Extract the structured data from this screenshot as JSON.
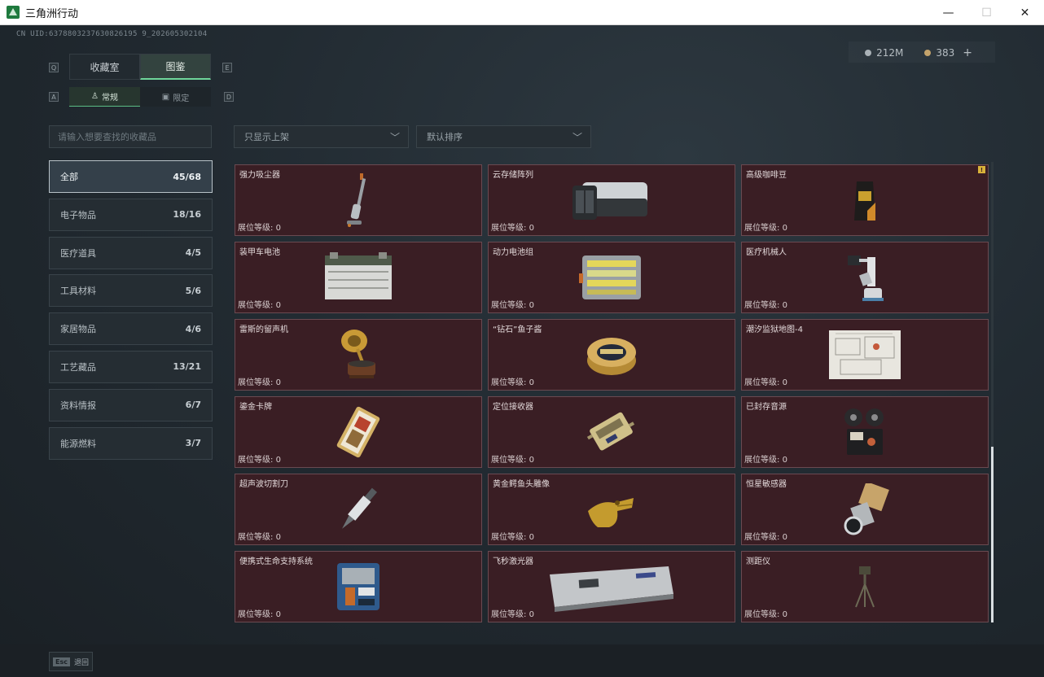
{
  "window": {
    "title": "三角洲行动",
    "minimize": "—",
    "maximize": "☐",
    "close": "✕"
  },
  "uid": "CN UID:6378803237630826195 9_202605302104",
  "currency": {
    "silver": "212M",
    "gold": "383",
    "add": "+"
  },
  "keys": {
    "prev_tab": "Q",
    "next_tab": "E",
    "prev_sub": "A",
    "next_sub": "D"
  },
  "tabs": [
    {
      "label": "收藏室"
    },
    {
      "label": "图鉴"
    }
  ],
  "subtabs": [
    {
      "label": "常规"
    },
    {
      "label": "限定"
    }
  ],
  "search": {
    "placeholder": "请输入想要查找的收藏品"
  },
  "filters": {
    "shelf": "只显示上架",
    "sort": "默认排序"
  },
  "categories": [
    {
      "label": "全部",
      "count": "45/68"
    },
    {
      "label": "电子物品",
      "count": "18/16"
    },
    {
      "label": "医疗道具",
      "count": "4/5"
    },
    {
      "label": "工具材料",
      "count": "5/6"
    },
    {
      "label": "家居物品",
      "count": "4/6"
    },
    {
      "label": "工艺藏品",
      "count": "13/21"
    },
    {
      "label": "资料情报",
      "count": "6/7"
    },
    {
      "label": "能源燃料",
      "count": "3/7"
    }
  ],
  "level_label": "展位等级:",
  "items": [
    {
      "name": "强力吸尘器",
      "level": "0"
    },
    {
      "name": "云存储阵列",
      "level": "0"
    },
    {
      "name": "高级咖啡豆",
      "level": "0",
      "alert": "!"
    },
    {
      "name": "装甲车电池",
      "level": "0"
    },
    {
      "name": "动力电池组",
      "level": "0"
    },
    {
      "name": "医疗机械人",
      "level": "0"
    },
    {
      "name": "雷斯的留声机",
      "level": "0"
    },
    {
      "name": "“钻石”鱼子酱",
      "level": "0"
    },
    {
      "name": "潮汐监狱地图-4",
      "level": "0"
    },
    {
      "name": "鎏金卡牌",
      "level": "0"
    },
    {
      "name": "定位接收器",
      "level": "0"
    },
    {
      "name": "已封存音源",
      "level": "0"
    },
    {
      "name": "超声波切割刀",
      "level": "0"
    },
    {
      "name": "黄金鳄鱼头雕像",
      "level": "0"
    },
    {
      "name": "恒星敏感器",
      "level": "0"
    },
    {
      "name": "便携式生命支持系统",
      "level": "0"
    },
    {
      "name": "飞秒激光器",
      "level": "0"
    },
    {
      "name": "测距仪",
      "level": "0"
    }
  ],
  "back": {
    "key": "Esc",
    "label": "退回"
  }
}
